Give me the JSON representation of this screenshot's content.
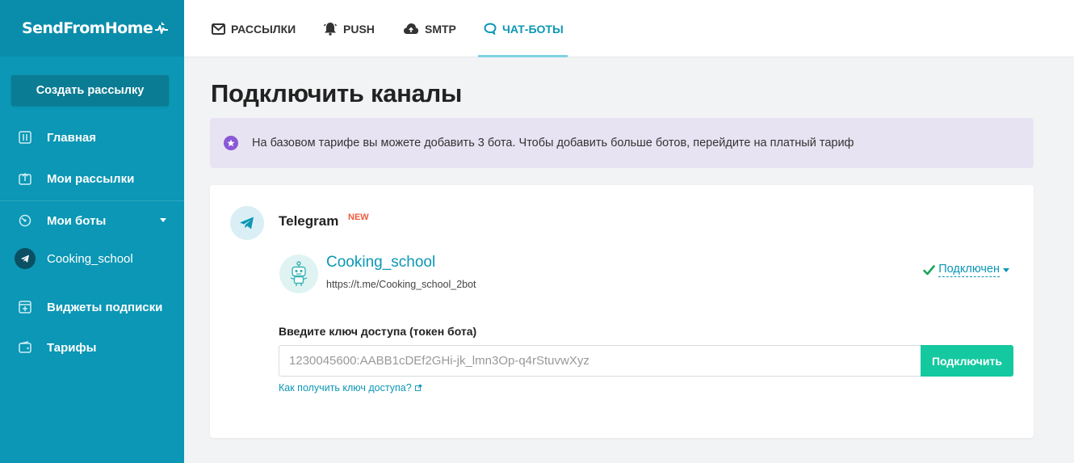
{
  "brand": {
    "logo_text": "SendFromHome"
  },
  "sidebar": {
    "create_button": "Создать рассылку",
    "items": [
      {
        "label": "Главная",
        "icon": "sliders-icon"
      },
      {
        "label": "Мои рассылки",
        "icon": "upload-box-icon"
      },
      {
        "label": "Мои боты",
        "icon": "bot-face-icon"
      },
      {
        "label": "Cooking_school",
        "icon": "telegram-icon"
      },
      {
        "label": "Виджеты подписки",
        "icon": "widget-plus-icon"
      },
      {
        "label": "Тарифы",
        "icon": "wallet-icon"
      }
    ]
  },
  "topnav": {
    "tabs": [
      {
        "label": "РАССЫЛКИ",
        "icon": "envelope-icon",
        "active": false
      },
      {
        "label": "PUSH",
        "icon": "bell-icon",
        "active": false
      },
      {
        "label": "SMTP",
        "icon": "cloud-icon",
        "active": false
      },
      {
        "label": "ЧАТ-БОТЫ",
        "icon": "chat-icon",
        "active": true
      }
    ]
  },
  "main": {
    "title": "Подключить каналы",
    "notice": "На базовом тарифе вы можете добавить 3 бота. Чтобы добавить больше ботов, перейдите на платный тариф",
    "channel": {
      "name": "Telegram",
      "badge": "NEW",
      "bot_name": "Cooking_school",
      "bot_link": "https://t.me/Cooking_school_2bot",
      "status": "Подключен",
      "token_label": "Введите ключ доступа (токен бота)",
      "token_placeholder": "1230045600:AABB1cDEf2GHi-jk_lmn3Op-q4rStuvwXyz",
      "token_value": "",
      "connect_button": "Подключить",
      "help_link": "Как получить ключ доступа?"
    }
  },
  "colors": {
    "sidebar_bg": "#0b97b5",
    "accent": "#0b97b5",
    "connect_green": "#14c8a0",
    "notice_bg": "#e8e3f2",
    "new_badge": "#f05a3a",
    "status_check": "#1aa65a"
  }
}
